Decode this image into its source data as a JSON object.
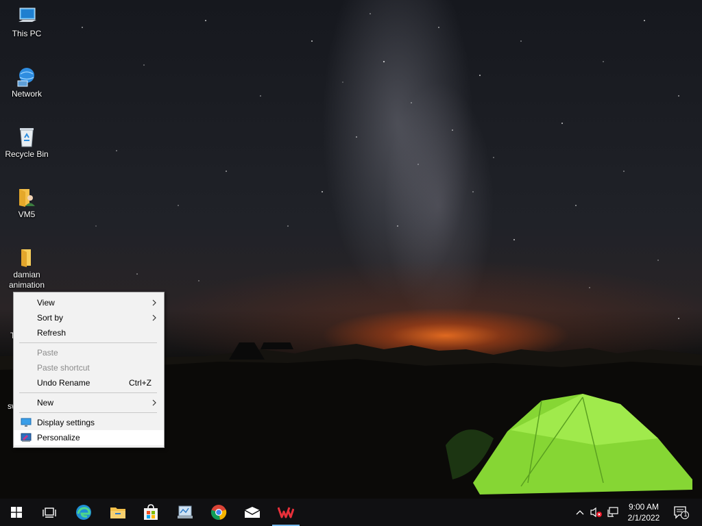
{
  "desktop": {
    "icons": [
      {
        "label": "This PC",
        "icon": "this-pc-icon"
      },
      {
        "label": "Network",
        "icon": "network-icon"
      },
      {
        "label": "Recycle Bin",
        "icon": "recycle-bin-icon"
      },
      {
        "label": "VM5",
        "icon": "user-folder-icon"
      },
      {
        "label": "damian animation",
        "icon": "folder-icon"
      }
    ],
    "partial_labels": [
      "T",
      "sw"
    ]
  },
  "context_menu": {
    "items": [
      {
        "label": "View",
        "submenu": true,
        "enabled": true
      },
      {
        "label": "Sort by",
        "submenu": true,
        "enabled": true
      },
      {
        "label": "Refresh",
        "enabled": true
      },
      {
        "label": "Paste",
        "enabled": false
      },
      {
        "label": "Paste shortcut",
        "enabled": false
      },
      {
        "label": "Undo Rename",
        "shortcut": "Ctrl+Z",
        "enabled": true
      },
      {
        "label": "New",
        "submenu": true,
        "enabled": true
      },
      {
        "label": "Display settings",
        "icon": "display-settings-icon",
        "enabled": true
      },
      {
        "label": "Personalize",
        "icon": "personalize-icon",
        "enabled": true,
        "highlighted": true
      }
    ]
  },
  "taskbar": {
    "pinned": [
      {
        "name": "start",
        "icon": "windows-logo-icon"
      },
      {
        "name": "task-view",
        "icon": "task-view-icon"
      },
      {
        "name": "edge",
        "icon": "edge-icon"
      },
      {
        "name": "file-explorer",
        "icon": "file-explorer-icon"
      },
      {
        "name": "store",
        "icon": "store-icon"
      },
      {
        "name": "control-panel",
        "icon": "control-panel-icon"
      },
      {
        "name": "chrome",
        "icon": "chrome-icon"
      },
      {
        "name": "mail",
        "icon": "mail-icon"
      },
      {
        "name": "wps-office",
        "icon": "wps-office-icon",
        "active": true
      }
    ],
    "tray": {
      "icons": [
        "chevron-up-icon",
        "volume-muted-icon",
        "network-status-icon"
      ],
      "time": "9:00 AM",
      "date": "2/1/2022",
      "notification_count": "1"
    }
  },
  "colors": {
    "taskbar_bg": "#101012",
    "menu_bg": "#f2f2f2",
    "menu_highlight": "#ffffff",
    "disabled_text": "#8a8a8a",
    "active_indicator": "#76b9ed",
    "tent_green": "#8ee03a"
  }
}
